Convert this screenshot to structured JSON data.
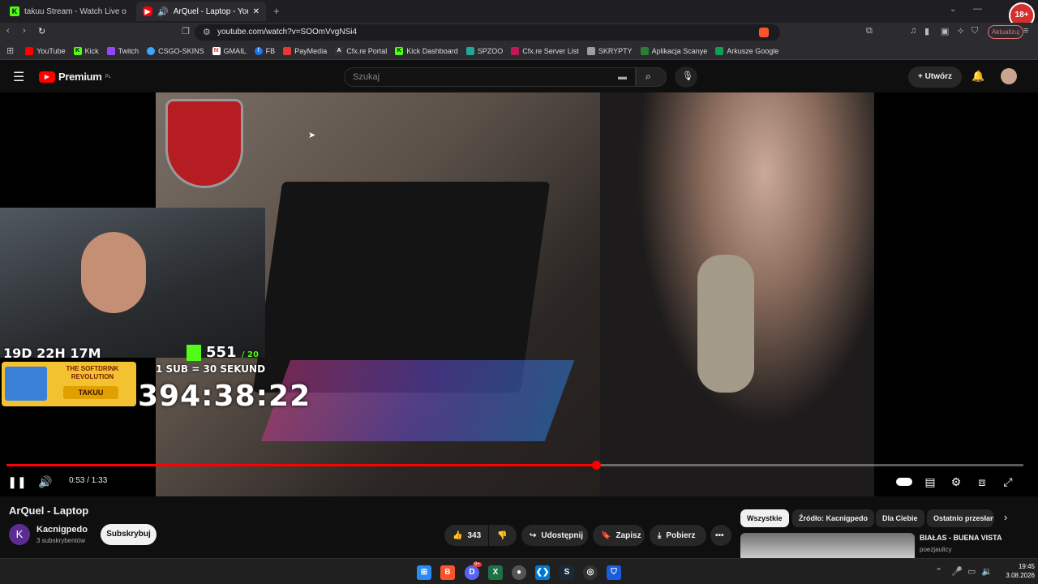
{
  "browser": {
    "tabs": [
      {
        "title": "takuu Stream - Watch Live on Kick",
        "active": false
      },
      {
        "title": "ArQuel - Laptop - YouTube",
        "active": true
      }
    ],
    "new_tab": "+",
    "url": "youtube.com/watch?v=SOOmVvgNSi4",
    "update_label": "Aktualizuj",
    "age_badge": "18+",
    "bookmarks": [
      {
        "label": "YouTube",
        "color": "#ff0000"
      },
      {
        "label": "Kick",
        "color": "#53fc18"
      },
      {
        "label": "Twitch",
        "color": "#9146ff"
      },
      {
        "label": "CSGO-SKINS",
        "color": "#3ea6ff"
      },
      {
        "label": "GMAIL",
        "color": "#ea4335"
      },
      {
        "label": "FB",
        "color": "#1877f2"
      },
      {
        "label": "PayMedia",
        "color": "#e53935"
      },
      {
        "label": "Cfx.re Portal",
        "color": "#ffffff"
      },
      {
        "label": "Kick Dashboard",
        "color": "#53fc18"
      },
      {
        "label": "SPZOO",
        "color": "#26a69a"
      },
      {
        "label": "Cfx.re Server List",
        "color": "#c2185b"
      },
      {
        "label": "SKRYPTY",
        "color": "#9e9e9e"
      },
      {
        "label": "Aplikacja Scanye",
        "color": "#2e7d32"
      },
      {
        "label": "Arkusze Google",
        "color": "#0f9d58"
      }
    ]
  },
  "youtube": {
    "logo_text": "Premium",
    "region": "PL",
    "search_placeholder": "Szukaj",
    "create_label": "Utwórz",
    "video": {
      "overlay_timer_small": "19D 22H 17M",
      "overlay_count": "551",
      "overlay_count_suffix": "/ 20",
      "overlay_rule": "1 SUB = 30 SEKUND",
      "overlay_big_timer": "394:38:22",
      "promo_line1": "THE SOFTDRINK",
      "promo_line2": "REVOLUTION",
      "promo_button": "TAKUU",
      "progress": 0.58,
      "time_current": "0:53",
      "time_total": "1:33",
      "time_display": "0:53 / 1:33"
    },
    "title": "ArQuel - Laptop",
    "channel": {
      "initial": "K",
      "name": "Kacnigpedo",
      "subscribers": "3 subskrybentów",
      "subscribe_label": "Subskrybuj"
    },
    "actions": {
      "likes": "343",
      "share": "Udostępnij",
      "save": "Zapisz",
      "download": "Pobierz"
    },
    "chips": [
      "Wszystkie",
      "Źródło: Kacnigpedo",
      "Dla Ciebie",
      "Ostatnio przesłane"
    ],
    "recommendation": {
      "title": "BIAŁAS - BUENA VISTA",
      "channel": "poezjaulicy"
    }
  },
  "taskbar": {
    "time": "19:45",
    "date": "3.08.2026",
    "discord_badge": "9+"
  }
}
